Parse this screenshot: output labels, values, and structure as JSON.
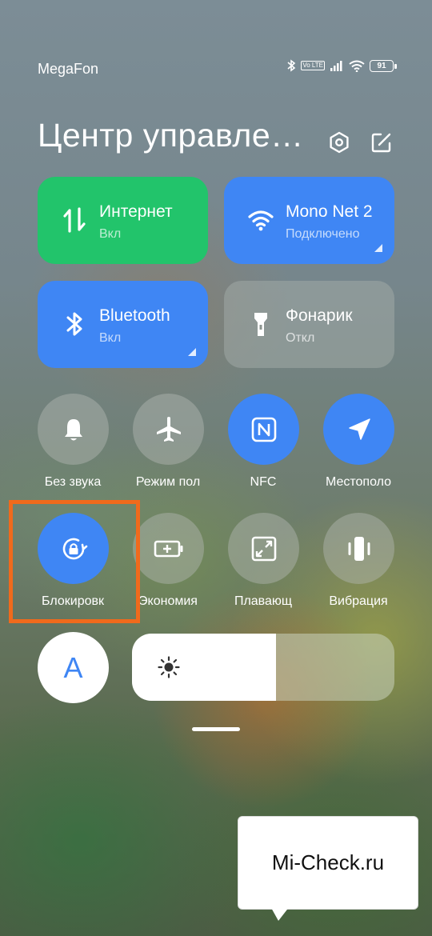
{
  "status_bar": {
    "carrier": "MegaFon",
    "battery": "91",
    "volte": "Vo LTE"
  },
  "header": {
    "title": "Центр управле…"
  },
  "tiles": [
    {
      "label": "Интернет",
      "sub": "Вкл",
      "color": "#22c46b"
    },
    {
      "label": "Mono Net 2",
      "sub": "Подключено",
      "color": "#3f86f4"
    },
    {
      "label": "Bluetooth",
      "sub": "Вкл",
      "color": "#3f86f4"
    },
    {
      "label": "Фонарик",
      "sub": "Откл",
      "color": "rgba(160,170,165,0.55)"
    }
  ],
  "toggles_row1": [
    {
      "label": "Без звука",
      "active": false
    },
    {
      "label": "Режим пол",
      "active": false
    },
    {
      "label": "NFC",
      "active": true
    },
    {
      "label": "Местополо",
      "active": true
    }
  ],
  "toggles_row2": [
    {
      "label": "Блокировк",
      "active": true
    },
    {
      "label": "Экономия",
      "active": false
    },
    {
      "label": "Плавающ",
      "active": false
    },
    {
      "label": "Вибрация",
      "active": false
    }
  ],
  "font_toggle": {
    "letter": "A"
  },
  "brightness": {
    "level": 0.55
  },
  "watermark": {
    "text": "Mi-Check.ru"
  },
  "colors": {
    "active": "#3f86f4",
    "inactive": "rgba(180,185,180,0.45)",
    "highlight": "#f06a1c"
  }
}
